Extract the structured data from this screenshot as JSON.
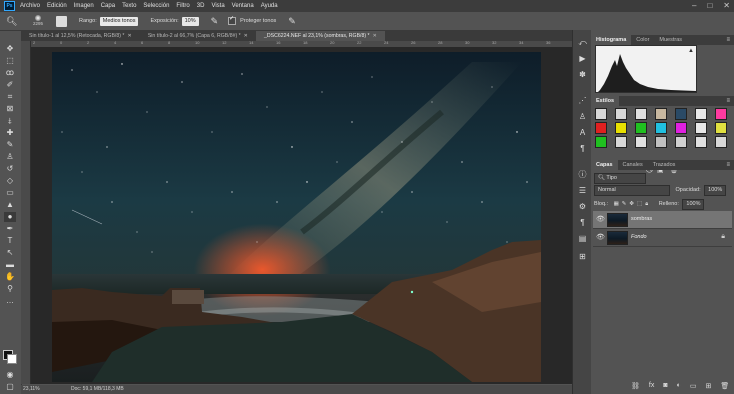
{
  "app": {
    "logo": "Ps"
  },
  "menu": [
    "Archivo",
    "Edición",
    "Imagen",
    "Capa",
    "Texto",
    "Selección",
    "Filtro",
    "3D",
    "Vista",
    "Ventana",
    "Ayuda"
  ],
  "options": {
    "brush_size": "2295",
    "range_label": "Rango:",
    "range_value": "Medios tonos",
    "exposure_label": "Exposición:",
    "exposure_value": "10%",
    "protect_label": "Proteger tonos"
  },
  "tabs": [
    {
      "label": "Sin título-1 al 12,5% (Retocada, RGB/8) *"
    },
    {
      "label": "Sin título-2 al 66,7% (Capa 6, RGB/8#) *"
    },
    {
      "label": "_DSC6224.NEF al 23,1% (sombras, RGB/8) *"
    }
  ],
  "ruler_numbers": [
    "2",
    "0",
    "2",
    "4",
    "6",
    "8",
    "10",
    "12",
    "14",
    "16",
    "18",
    "20",
    "22",
    "24",
    "26",
    "28",
    "30",
    "32",
    "34",
    "36"
  ],
  "status": {
    "zoom": "23,11%",
    "doc": "Doc: 59,1 MB/118,3 MB"
  },
  "panels": {
    "histogram_tabs": [
      "Histograma",
      "Color",
      "Muestras"
    ],
    "styles_tab": "Estilos",
    "layers_tabs": [
      "Capas",
      "Canales",
      "Trazados"
    ],
    "kind_filter": "Tipo",
    "blend_mode": "Normal",
    "opacity_label": "Opacidad:",
    "opacity_value": "100%",
    "lock_label": "Bloq.:",
    "fill_label": "Relleno:",
    "fill_value": "100%",
    "layers": [
      {
        "name": "sombras",
        "active": true
      },
      {
        "name": "Fondo",
        "active": false
      }
    ]
  },
  "style_colors": [
    "#d8d8d8",
    "#d8d8d8",
    "#e0e0e0",
    "#c8b8a0",
    "#2a4a66",
    "#e8e8e8",
    "#ff3aa0",
    "#e02020",
    "#e8e000",
    "#20c020",
    "#20c0e0",
    "#e020e0",
    "#e8e8e8",
    "#e0e040",
    "#20c020",
    "#d8d8d8",
    "#e0e0e0",
    "#c0c0c0",
    "#d0d0d0",
    "#e0e0e0",
    "#d8d8d8"
  ]
}
